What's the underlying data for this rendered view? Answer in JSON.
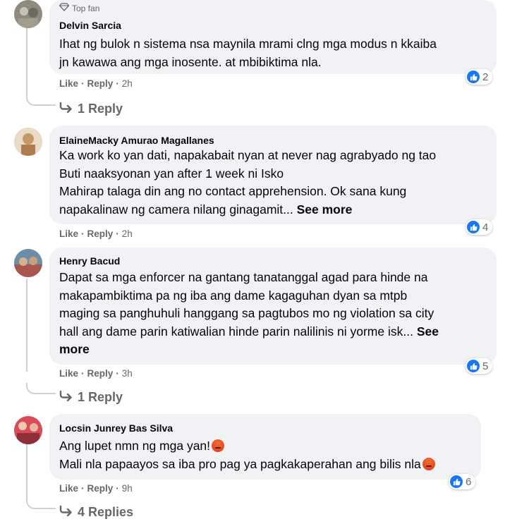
{
  "comments": [
    {
      "author": "Delvin Sarcia",
      "badge": "Top fan",
      "lines": [
        "Ihat ng bulok n sistema nsa maynila mrami clng mga modus n kkaiba",
        "jn kawawa ang mga inosente. at mbibiktima nla."
      ],
      "see_more": "",
      "like": "Like",
      "reply": "Reply",
      "time": "2h",
      "reactions": "2",
      "replies": "1 Reply"
    },
    {
      "author": "ElaineMacky Amurao Magallanes",
      "lines": [
        "Ka work ko yan dati, napakabait nyan at never nag agrabyado ng tao",
        "Buti naaksyonan yan after 1 week ni Isko",
        "Mahirap talaga din ang no contact apprehension. Ok sana kung",
        "napakalinaw ng camera nilang ginagamit..."
      ],
      "see_more": "See more",
      "like": "Like",
      "reply": "Reply",
      "time": "2h",
      "reactions": "4"
    },
    {
      "author": "Henry Bacud",
      "lines": [
        "Dapat sa mga enforcer na gantang tanatanggal agad para hinde na",
        "makapambiktima pa ng iba ang dame kagaguhan dyan sa mtpb",
        "maging sa panghuhuli hanggang sa pagtubos mo ng violation sa city",
        "hall ang dame parin katiwalian hinde parin nalilinis ni yorme isk..."
      ],
      "see_more_inline": "See",
      "see_more_cont": "more",
      "like": "Like",
      "reply": "Reply",
      "time": "3h",
      "reactions": "5",
      "replies": "1 Reply"
    },
    {
      "author": "Locsin Junrey Bas Silva",
      "lines": [
        "Ang lupet nmn ng mga yan!",
        "Mali nla papaayos sa iba pro pag ya pagkakaperahan ang bilis nla"
      ],
      "like": "Like",
      "reply": "Reply",
      "time": "9h",
      "reactions": "6",
      "replies": "4 Replies"
    }
  ],
  "icons": {
    "like": "like-icon",
    "reply_arrow": "reply-arrow-icon",
    "badge": "top-fan-diamond-icon",
    "emoji": "angry-emoji-icon"
  },
  "colors": {
    "bubble": "#f0f2f5",
    "secondary_text": "#65676b",
    "like_blue": "#1877f2",
    "thread_line": "#ced0d4"
  }
}
